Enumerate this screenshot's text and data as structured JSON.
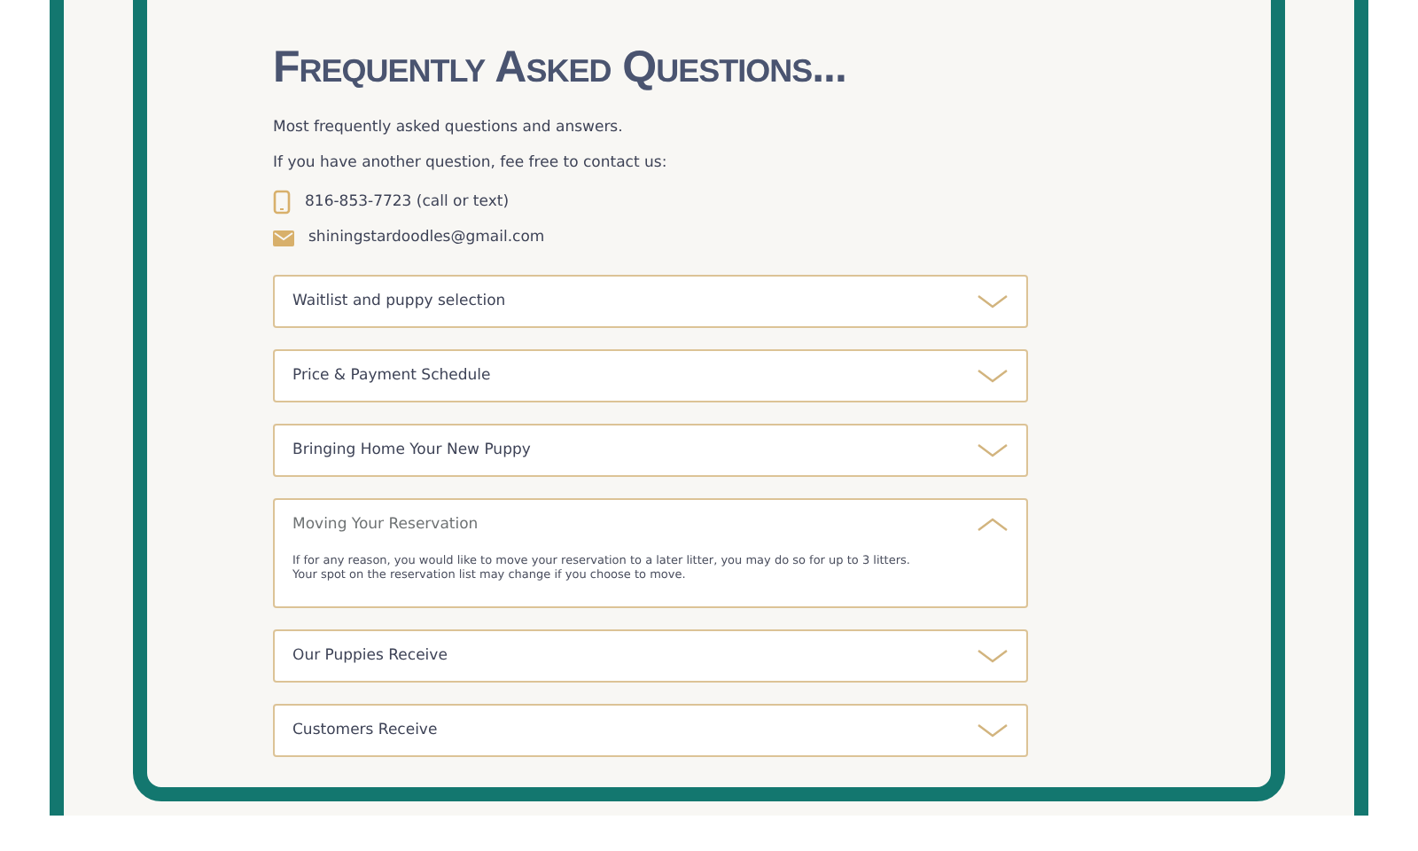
{
  "title": "Frequently Asked Questions...",
  "intro": [
    "Most frequently asked questions and answers.",
    "If you have another question, fee free to contact us:"
  ],
  "contacts": [
    {
      "kind": "phone",
      "text": "816-853-7723 (call or text)"
    },
    {
      "kind": "email",
      "text": "shiningstardoodles@gmail.com"
    }
  ],
  "faqs": [
    {
      "question": "Waitlist and puppy selection",
      "expanded": false
    },
    {
      "question": "Price & Payment Schedule",
      "expanded": false
    },
    {
      "question": "Bringing Home Your New Puppy",
      "expanded": false
    },
    {
      "question": "Moving Your Reservation",
      "expanded": true,
      "answer": "If for any reason, you would like to move your reservation to a later litter, you may do so for up to 3 litters. Your spot on the reservation list may change if you choose to move."
    },
    {
      "question": "Our Puppies Receive",
      "expanded": false
    },
    {
      "question": "Customers Receive",
      "expanded": false
    }
  ]
}
